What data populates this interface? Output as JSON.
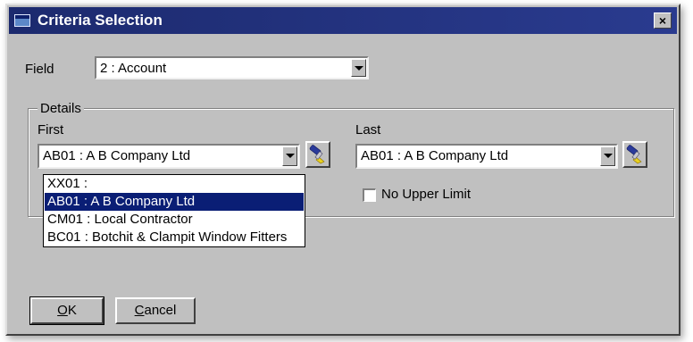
{
  "window": {
    "title": "Criteria Selection",
    "close_glyph": "×"
  },
  "field": {
    "label": "Field",
    "value": "2 : Account"
  },
  "details": {
    "legend": "Details",
    "first": {
      "label": "First",
      "value": "AB01  : A B Company Ltd",
      "options": [
        "XX01  :",
        "AB01  : A B Company Ltd",
        "CM01  : Local Contractor",
        "BC01  : Botchit & Clampit Window Fitters"
      ],
      "selected_index": 1
    },
    "last": {
      "label": "Last",
      "value": "AB01  : A B Company Ltd"
    },
    "no_upper_limit": {
      "label": "No Upper Limit",
      "checked": false
    }
  },
  "buttons": {
    "ok": {
      "mnemonic": "O",
      "rest": "K"
    },
    "cancel": {
      "mnemonic": "C",
      "rest": "ancel"
    }
  },
  "icons": [
    "window-icon",
    "close-icon",
    "chevron-down-icon",
    "flashlight-icon"
  ],
  "colors": {
    "title_bar": "#1c2a6e",
    "face": "#c0c0c0",
    "selection": "#0a1e75"
  }
}
